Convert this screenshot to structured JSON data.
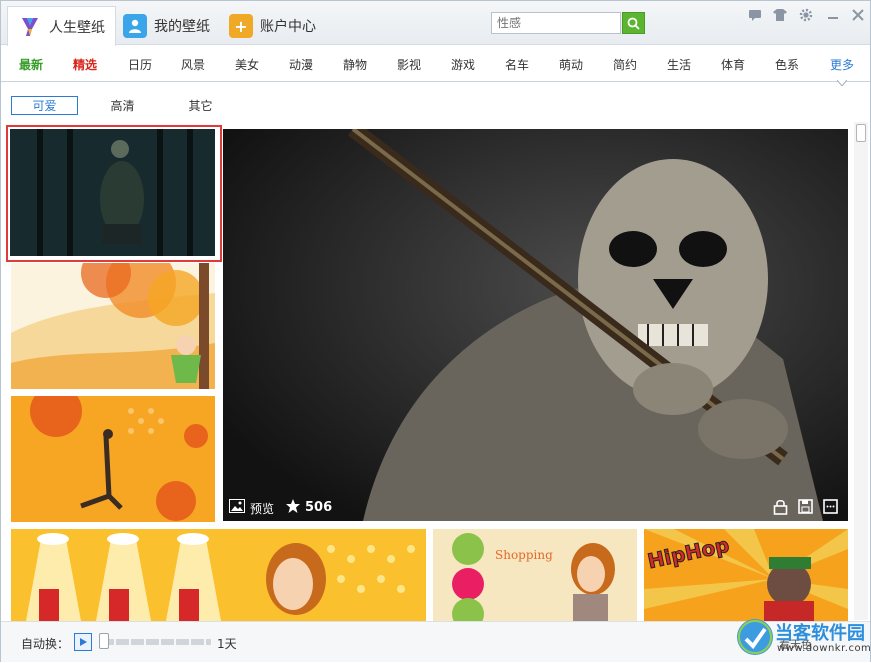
{
  "app": {
    "tabs": [
      {
        "label": "人生壁纸",
        "active": true
      },
      {
        "label": "我的壁纸",
        "active": false
      },
      {
        "label": "账户中心",
        "active": false
      }
    ],
    "search": {
      "placeholder": "性感"
    }
  },
  "categories": [
    "最新",
    "精选",
    "日历",
    "风景",
    "美女",
    "动漫",
    "静物",
    "影视",
    "游戏",
    "名车",
    "萌动",
    "简约",
    "生活",
    "体育",
    "色系",
    "更多"
  ],
  "subtabs": [
    "可爱",
    "高清",
    "其它"
  ],
  "featured": {
    "preview_label": "预览",
    "stars": "506"
  },
  "bottom": {
    "auto_label": "自动换：",
    "interval": "1天",
    "set_label": "看天色"
  },
  "watermark": {
    "brand": "当客软件园",
    "url": "www.downkr.com"
  },
  "colors": {
    "accent": "#2b7bd5",
    "selected_border": "#e03b3b",
    "search_button": "#5cb531"
  }
}
